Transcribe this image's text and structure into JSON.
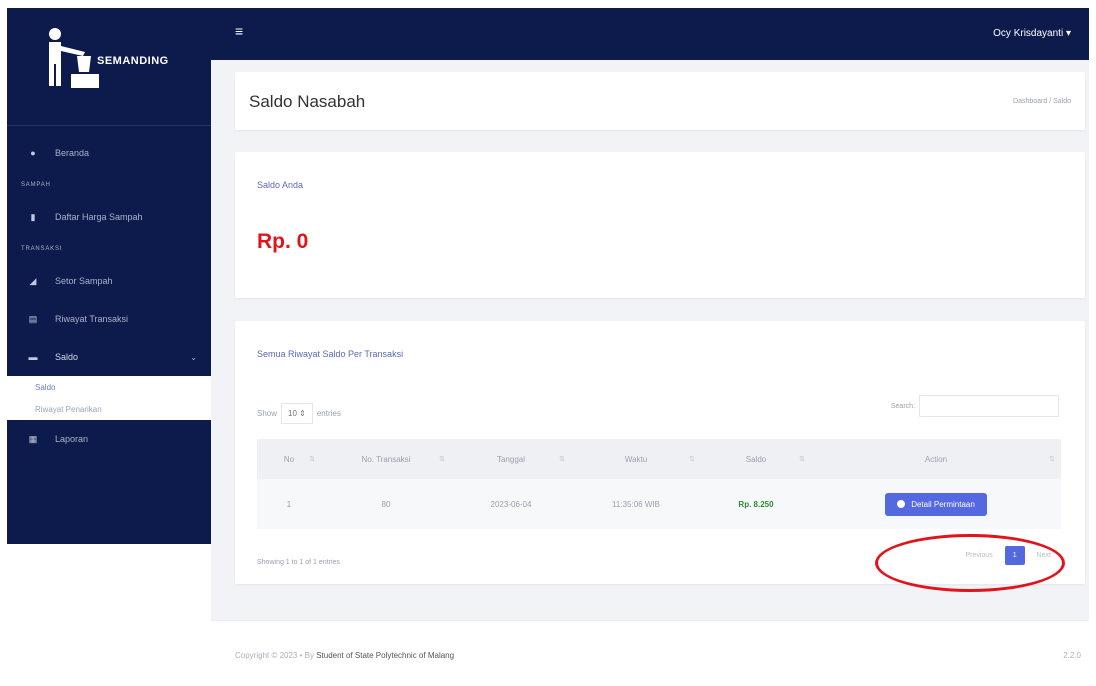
{
  "app": {
    "brand": "SEMANDING"
  },
  "sidebar": {
    "home": "Beranda",
    "section_sampah": "SAMPAH",
    "daftar_harga": "Daftar Harga Sampah",
    "section_transaksi": "TRANSAKSI",
    "setor_sampah": "Setor Sampah",
    "riwayat_transaksi": "Riwayat Transaksi",
    "saldo": "Saldo",
    "sub_saldo": "Saldo",
    "sub_riwayat_penarikan": "Riwayat Penarikan",
    "laporan": "Laporan"
  },
  "topbar": {
    "user": "Ocy Krisdayanti"
  },
  "page": {
    "title": "Saldo Nasabah",
    "breadcrumb": "Dashboard / Saldo"
  },
  "saldo_card": {
    "label": "Saldo Anda",
    "value": "Rp. 0"
  },
  "table_card": {
    "heading": "Semua Riwayat Saldo Per Transaksi",
    "show": "Show",
    "entries_value": "10",
    "entries": "entries",
    "search_label": "Search:",
    "columns": [
      "No",
      "No. Transaksi",
      "Tanggal",
      "Waktu",
      "Saldo",
      "Action"
    ],
    "rows": [
      {
        "no": "1",
        "no_transaksi": "80",
        "tanggal": "2023-06-04",
        "waktu": "11:35:06 WIB",
        "saldo": "Rp. 8.250",
        "action": "Detail Permintaan"
      }
    ],
    "info": "Showing 1 to 1 of 1 entries",
    "prev": "Previous",
    "page": "1",
    "next": "Next"
  },
  "footer": {
    "copyright": "Copyright © 2023 • By",
    "credit": "Student of State Polytechnic of Malang",
    "version": "2.2.0"
  },
  "colors": {
    "sidebar": "#0d1b4c",
    "accent": "#5468e0",
    "saldo": "#e0141a",
    "table_saldo": "#2e8b3a"
  }
}
